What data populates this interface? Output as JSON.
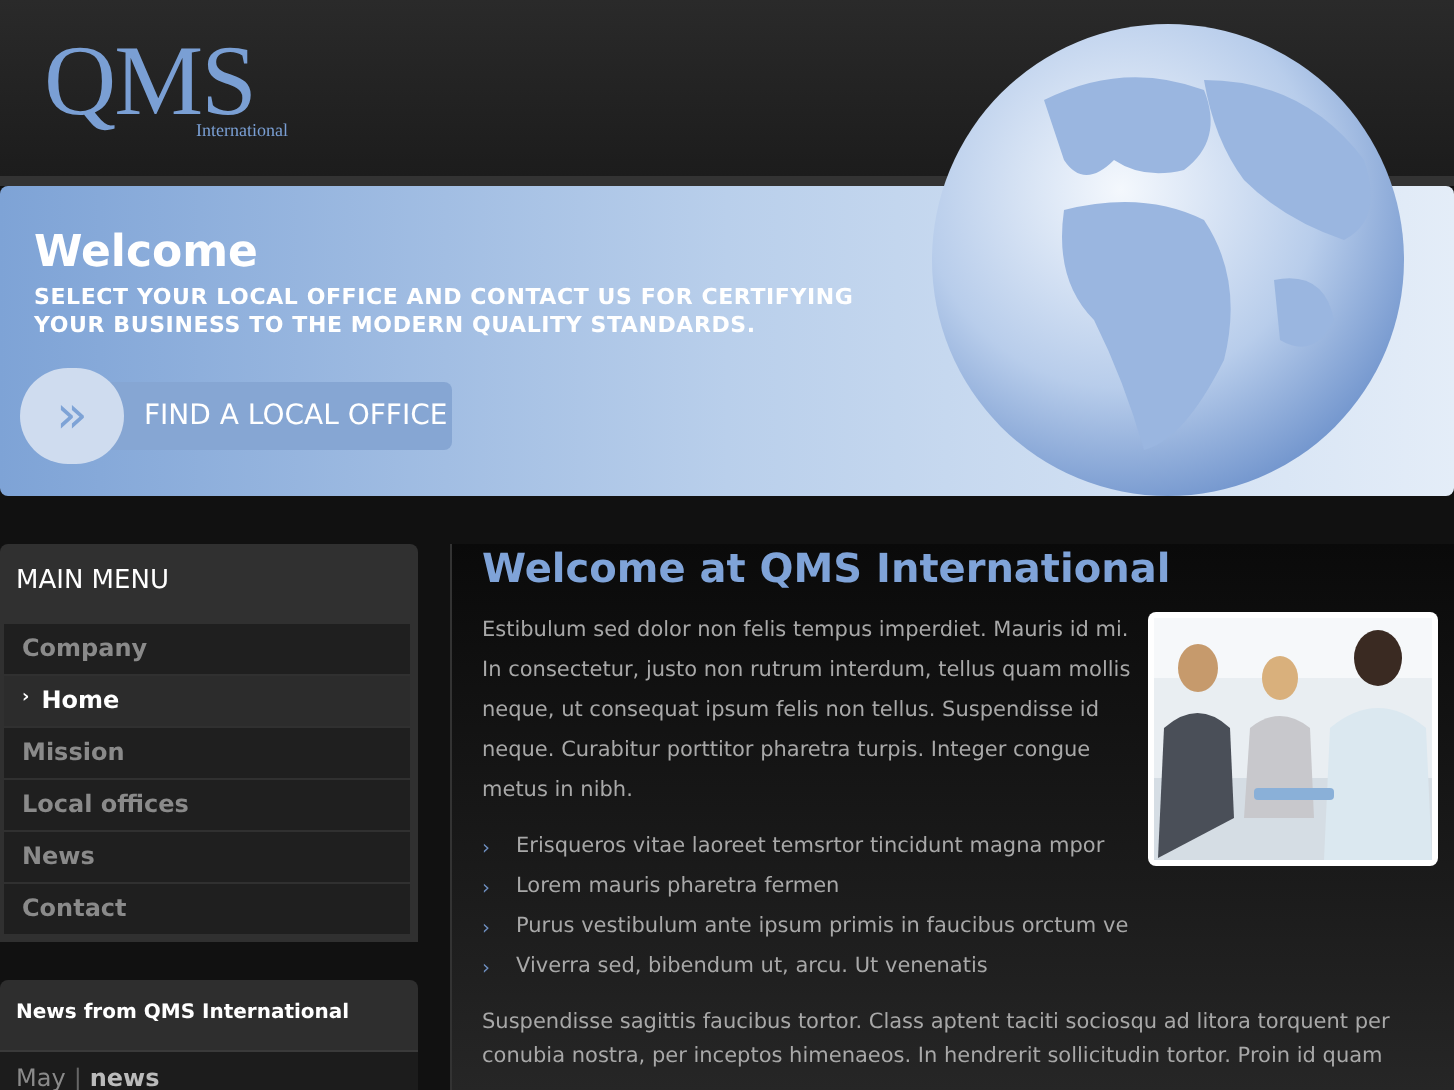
{
  "logo": {
    "name": "QMS",
    "subtitle": "International"
  },
  "banner": {
    "title": "Welcome",
    "text": "SELECT YOUR LOCAL OFFICE AND CONTACT US FOR CERTIFYING YOUR BUSINESS TO THE MODERN QUALITY STANDARDS.",
    "button": {
      "icon": "»",
      "label": "FIND A LOCAL OFFICE"
    }
  },
  "main_menu": {
    "title": "MAIN MENU",
    "items": [
      {
        "label": "Company",
        "selected": false
      },
      {
        "label": "Home",
        "selected": true
      },
      {
        "label": "Mission",
        "selected": false
      },
      {
        "label": "Local offices",
        "selected": false
      },
      {
        "label": "News",
        "selected": false
      },
      {
        "label": "Contact",
        "selected": false
      }
    ]
  },
  "news_box": {
    "title": "News from QMS International",
    "date": "May",
    "separator": "|",
    "label": "news"
  },
  "content": {
    "title": "Welcome at QMS International",
    "intro": "Estibulum sed dolor non felis tempus imperdiet. Mauris id mi. In consectetur, justo non rutrum interdum, tellus quam mollis neque, ut consequat ipsum felis non tellus. Suspendisse id neque. Curabitur porttitor pharetra turpis. Integer congue metus in nibh.",
    "bullets": [
      {
        "marker": "›",
        "text": "Erisqueros vitae laoreet temsrtor tincidunt magna mpor"
      },
      {
        "marker": "›",
        "text": "Lorem mauris pharetra fermen"
      },
      {
        "marker": "›",
        "text": "Purus vestibulum ante ipsum primis in faucibus orctum ve"
      },
      {
        "marker": "›",
        "text": "Viverra sed, bibendum ut, arcu. Ut venenatis"
      }
    ],
    "outro": "Suspendisse sagittis faucibus tortor. Class aptent taciti sociosqu ad litora torquent per conubia nostra, per inceptos himenaeos. In hendrerit sollicitudin tortor. Proin id quam"
  }
}
